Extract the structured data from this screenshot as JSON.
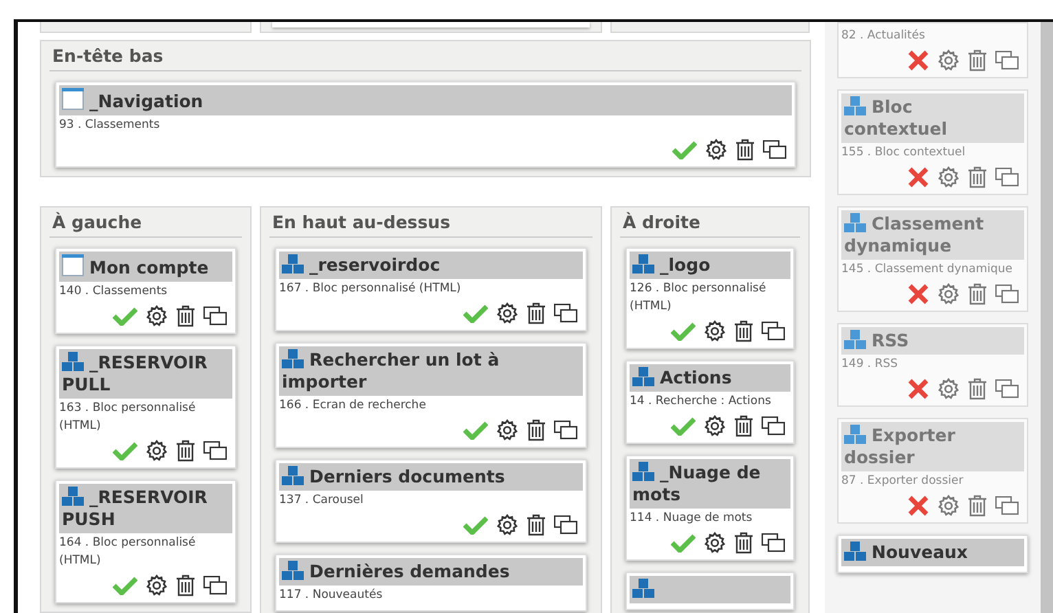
{
  "zones": [
    {
      "title": "En-tête bas",
      "blocks": [
        {
          "kind": "page",
          "title": "_Navigation",
          "subtitle": "93 . Classements",
          "active": true
        }
      ]
    }
  ],
  "columns": [
    {
      "title": "À gauche",
      "blocks": [
        {
          "kind": "page",
          "title": "Mon compte",
          "subtitle": "140 . Classements",
          "active": true
        },
        {
          "kind": "blocks",
          "title": "_RESERVOIR PULL",
          "subtitle": "163 . Bloc personnalisé (HTML)",
          "active": true
        },
        {
          "kind": "blocks",
          "title": "_RESERVOIR PUSH",
          "subtitle": "164 . Bloc personnalisé (HTML)",
          "active": true
        }
      ]
    },
    {
      "title": "En haut au-dessus",
      "blocks": [
        {
          "kind": "blocks",
          "title": "_reservoirdoc",
          "subtitle": "167 . Bloc personnalisé (HTML)",
          "active": true
        },
        {
          "kind": "blocks",
          "title": "Rechercher un lot à importer",
          "subtitle": "166 . Ecran de recherche",
          "active": true
        },
        {
          "kind": "blocks",
          "title": "Derniers documents",
          "subtitle": "137 . Carousel",
          "active": true
        },
        {
          "kind": "blocks",
          "title": "Dernières demandes",
          "subtitle": "117 . Nouveautés"
        }
      ]
    },
    {
      "title": "À droite",
      "blocks": [
        {
          "kind": "blocks",
          "title": "_logo",
          "subtitle": "126 . Bloc personnalisé (HTML)",
          "active": true
        },
        {
          "kind": "blocks",
          "title": "Actions",
          "subtitle": "14 . Recherche : Actions",
          "active": true
        },
        {
          "kind": "blocks",
          "title": "_Nuage de mots",
          "subtitle": "114 . Nuage de mots",
          "active": true
        },
        {
          "kind": "blocks"
        }
      ]
    }
  ],
  "sidebar": {
    "blocks": [
      {
        "subtitle": "82 . Actualités",
        "active": false
      },
      {
        "kind": "blocks",
        "title": "Bloc contextuel",
        "subtitle": "155 . Bloc contextuel",
        "active": false
      },
      {
        "kind": "blocks",
        "title": "Classement dynamique",
        "subtitle": "145 . Classement dynamique",
        "active": false
      },
      {
        "kind": "blocks",
        "title": "RSS",
        "subtitle": "149 . RSS",
        "active": false
      },
      {
        "kind": "blocks",
        "title": "Exporter dossier",
        "subtitle": "87 . Exporter dossier",
        "active": false
      },
      {
        "kind": "blocks",
        "title": "Nouveaux"
      }
    ]
  }
}
